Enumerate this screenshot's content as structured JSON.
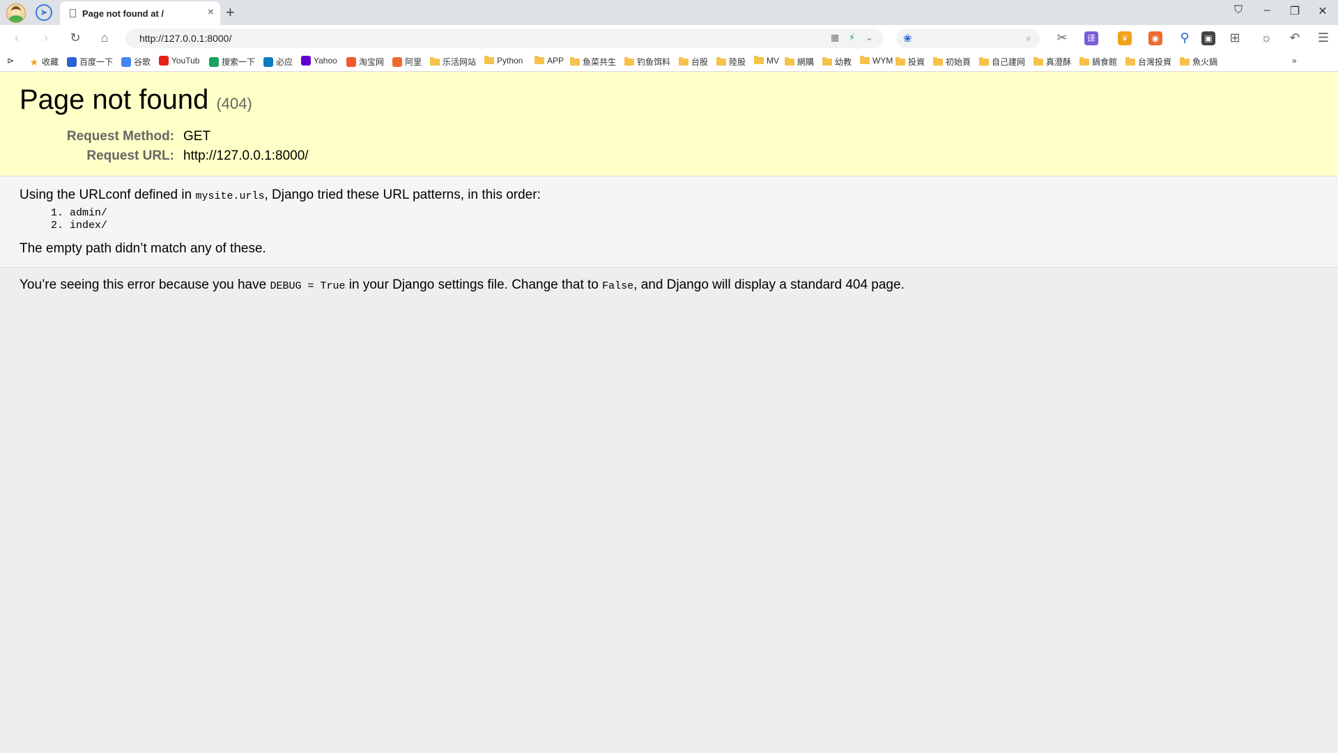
{
  "browser": {
    "tab": {
      "title": "Page not found at /"
    },
    "address_bar": {
      "url": "http://127.0.0.1:8000/"
    },
    "bookmarks": [
      {
        "label": "收藏",
        "type": "star"
      },
      {
        "label": "百度一下",
        "type": "site"
      },
      {
        "label": "谷歌",
        "type": "site"
      },
      {
        "label": "YouTub",
        "type": "site"
      },
      {
        "label": "搜索一下",
        "type": "site"
      },
      {
        "label": "必应",
        "type": "site"
      },
      {
        "label": "Yahoo",
        "type": "site"
      },
      {
        "label": "淘宝网",
        "type": "site"
      },
      {
        "label": "阿里",
        "type": "site"
      },
      {
        "label": "乐活网站",
        "type": "folder"
      },
      {
        "label": "Python",
        "type": "folder"
      },
      {
        "label": "APP",
        "type": "folder"
      },
      {
        "label": "鱼菜共生",
        "type": "folder"
      },
      {
        "label": "钓鱼饵料",
        "type": "folder"
      },
      {
        "label": "台股",
        "type": "folder"
      },
      {
        "label": "陸股",
        "type": "folder"
      },
      {
        "label": "MV",
        "type": "folder"
      },
      {
        "label": "網購",
        "type": "folder"
      },
      {
        "label": "幼教",
        "type": "folder"
      },
      {
        "label": "WYM",
        "type": "folder"
      },
      {
        "label": "投資",
        "type": "folder"
      },
      {
        "label": "初始頁",
        "type": "folder"
      },
      {
        "label": "自己建网",
        "type": "folder"
      },
      {
        "label": "真澄酥",
        "type": "folder"
      },
      {
        "label": "鍋食館",
        "type": "folder"
      },
      {
        "label": "台灣投資",
        "type": "folder"
      },
      {
        "label": "魚火鍋",
        "type": "folder"
      }
    ],
    "bookmarks_more": "»",
    "colors": {
      "accent": "#3a7bd5",
      "summary_bg": "#ffffc8"
    }
  },
  "page": {
    "title": "Page not found",
    "status_code": "(404)",
    "request_method_label": "Request Method:",
    "request_method": "GET",
    "request_url_label": "Request URL:",
    "request_url": "http://127.0.0.1:8000/",
    "urlconf_intro_before": "Using the URLconf defined in ",
    "urlconf_module": "mysite.urls",
    "urlconf_intro_after": ", Django tried these URL patterns, in this order:",
    "patterns": [
      "admin/",
      "index/"
    ],
    "no_match": "The empty path didn’t match any of these.",
    "explanation_before": "You’re seeing this error because you have ",
    "debug_setting": "DEBUG = True",
    "explanation_middle": " in your Django settings file. Change that to ",
    "false_value": "False",
    "explanation_after": ", and Django will display a standard 404 page."
  }
}
